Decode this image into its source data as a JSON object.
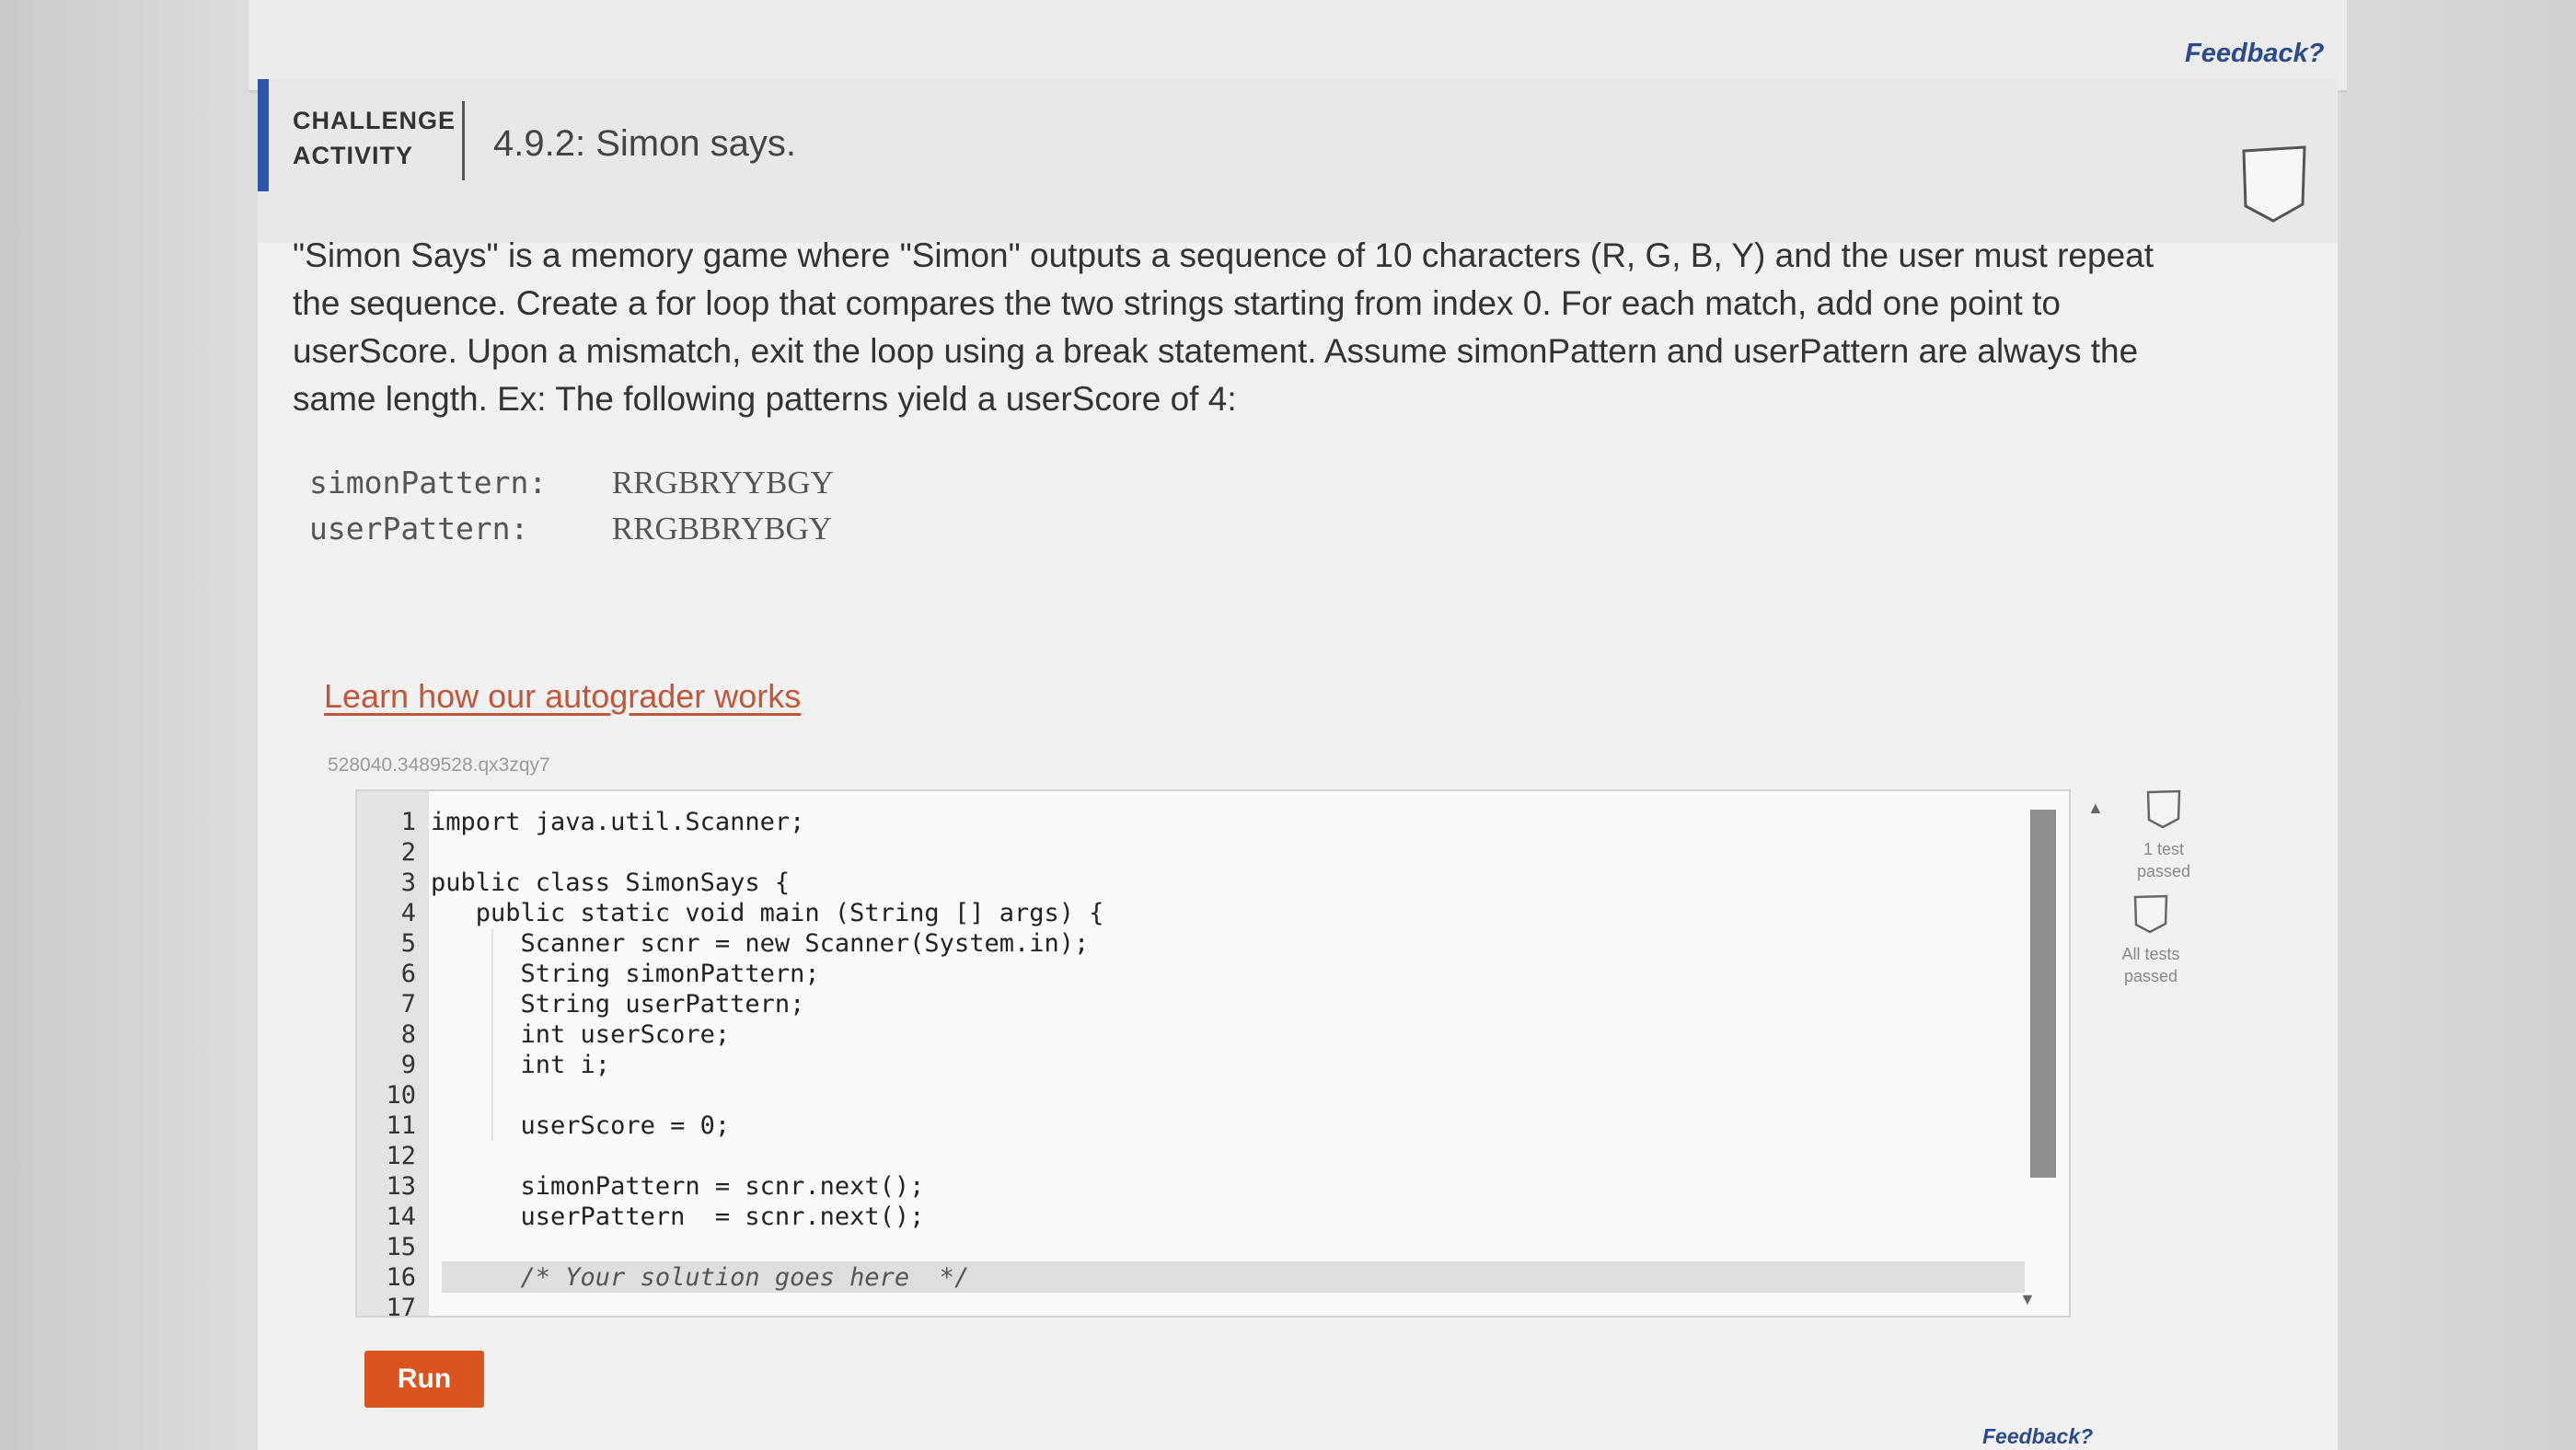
{
  "top": {
    "feedback_label": "Feedback?"
  },
  "header": {
    "label_line1": "CHALLENGE",
    "label_line2": "ACTIVITY",
    "title": "4.9.2: Simon says."
  },
  "description": "\"Simon Says\" is a memory game where \"Simon\" outputs a sequence of 10 characters (R, G, B, Y) and the user must repeat the sequence. Create a for loop that compares the two strings starting from index 0. For each match, add one point to userScore. Upon a mismatch, exit the loop using a break statement. Assume simonPattern and userPattern are always the same length. Ex: The following patterns yield a userScore of 4:",
  "example": {
    "rows": [
      {
        "key": "simonPattern:",
        "value": "RRGBRYYBGY"
      },
      {
        "key": "userPattern:",
        "value": "RRGBBRYBGY"
      }
    ]
  },
  "learn_link": "Learn how our autograder works",
  "activity_id": "528040.3489528.qx3zqy7",
  "editor": {
    "lines": [
      {
        "num": "1",
        "code": "import java.util.Scanner;"
      },
      {
        "num": "2",
        "code": ""
      },
      {
        "num": "3",
        "code": "public class SimonSays {"
      },
      {
        "num": "4",
        "code": "   public static void main (String [] args) {"
      },
      {
        "num": "5",
        "code": "      Scanner scnr = new Scanner(System.in);"
      },
      {
        "num": "6",
        "code": "      String simonPattern;"
      },
      {
        "num": "7",
        "code": "      String userPattern;"
      },
      {
        "num": "8",
        "code": "      int userScore;"
      },
      {
        "num": "9",
        "code": "      int i;"
      },
      {
        "num": "10",
        "code": ""
      },
      {
        "num": "11",
        "code": "      userScore = 0;"
      },
      {
        "num": "12",
        "code": ""
      },
      {
        "num": "13",
        "code": "      simonPattern = scnr.next();"
      },
      {
        "num": "14",
        "code": "      userPattern  = scnr.next();"
      },
      {
        "num": "15",
        "code": ""
      },
      {
        "num": "16",
        "code": "      /* Your solution goes here  */"
      },
      {
        "num": "17",
        "code": ""
      }
    ]
  },
  "status": {
    "one_test_line1": "1 test",
    "one_test_line2": "passed",
    "all_tests_line1": "All tests",
    "all_tests_line2": "passed"
  },
  "run_label": "Run",
  "bottom": {
    "feedback_label": "Feedback?"
  }
}
